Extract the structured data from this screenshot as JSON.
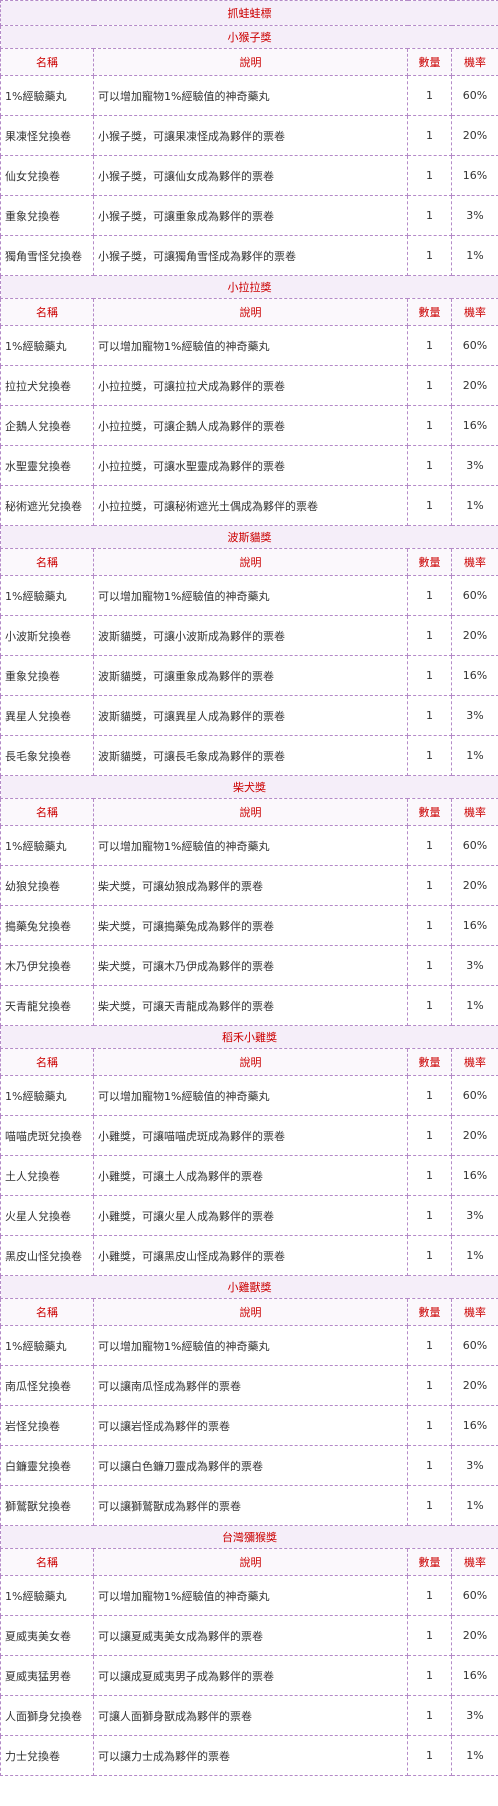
{
  "title": "抓蛙蛙標",
  "headers": {
    "name": "名稱",
    "desc": "說明",
    "qty": "數量",
    "rate": "機率"
  },
  "sections": [
    {
      "title": "小猴子獎",
      "rows": [
        {
          "name": "1%經驗藥丸",
          "desc": "可以增加寵物1%經驗值的神奇藥丸",
          "qty": "1",
          "rate": "60%"
        },
        {
          "name": "果凍怪兌換卷",
          "desc": "小猴子獎，可讓果凍怪成為夥伴的票卷",
          "qty": "1",
          "rate": "20%"
        },
        {
          "name": "仙女兌換卷",
          "desc": "小猴子獎，可讓仙女成為夥伴的票卷",
          "qty": "1",
          "rate": "16%"
        },
        {
          "name": "重象兌換卷",
          "desc": "小猴子獎，可讓重象成為夥伴的票卷",
          "qty": "1",
          "rate": "3%"
        },
        {
          "name": "獨角雪怪兌換卷",
          "desc": "小猴子獎，可讓獨角雪怪成為夥伴的票卷",
          "qty": "1",
          "rate": "1%"
        }
      ]
    },
    {
      "title": "小拉拉獎",
      "rows": [
        {
          "name": "1%經驗藥丸",
          "desc": "可以增加寵物1%經驗值的神奇藥丸",
          "qty": "1",
          "rate": "60%"
        },
        {
          "name": "拉拉犬兌換卷",
          "desc": "小拉拉獎，可讓拉拉犬成為夥伴的票卷",
          "qty": "1",
          "rate": "20%"
        },
        {
          "name": "企鵝人兌換卷",
          "desc": "小拉拉獎，可讓企鵝人成為夥伴的票卷",
          "qty": "1",
          "rate": "16%"
        },
        {
          "name": "水聖靈兌換卷",
          "desc": "小拉拉獎，可讓水聖靈成為夥伴的票卷",
          "qty": "1",
          "rate": "3%"
        },
        {
          "name": "秘術遮光兌換卷",
          "desc": "小拉拉獎，可讓秘術遮光土偶成為夥伴的票卷",
          "qty": "1",
          "rate": "1%"
        }
      ]
    },
    {
      "title": "波斯貓獎",
      "rows": [
        {
          "name": "1%經驗藥丸",
          "desc": "可以增加寵物1%經驗值的神奇藥丸",
          "qty": "1",
          "rate": "60%"
        },
        {
          "name": "小波斯兌換卷",
          "desc": "波斯貓獎，可讓小波斯成為夥伴的票卷",
          "qty": "1",
          "rate": "20%"
        },
        {
          "name": "重象兌換卷",
          "desc": "波斯貓獎，可讓重象成為夥伴的票卷",
          "qty": "1",
          "rate": "16%"
        },
        {
          "name": "異星人兌換卷",
          "desc": "波斯貓獎，可讓異星人成為夥伴的票卷",
          "qty": "1",
          "rate": "3%"
        },
        {
          "name": "長毛象兌換卷",
          "desc": "波斯貓獎，可讓長毛象成為夥伴的票卷",
          "qty": "1",
          "rate": "1%"
        }
      ]
    },
    {
      "title": "柴犬獎",
      "rows": [
        {
          "name": "1%經驗藥丸",
          "desc": "可以增加寵物1%經驗值的神奇藥丸",
          "qty": "1",
          "rate": "60%"
        },
        {
          "name": "幼狼兌換卷",
          "desc": "柴犬獎，可讓幼狼成為夥伴的票卷",
          "qty": "1",
          "rate": "20%"
        },
        {
          "name": "搗藥兔兌換卷",
          "desc": "柴犬獎，可讓搗藥兔成為夥伴的票卷",
          "qty": "1",
          "rate": "16%"
        },
        {
          "name": "木乃伊兌換卷",
          "desc": "柴犬獎，可讓木乃伊成為夥伴的票卷",
          "qty": "1",
          "rate": "3%"
        },
        {
          "name": "天青龍兌換卷",
          "desc": "柴犬獎，可讓天青龍成為夥伴的票卷",
          "qty": "1",
          "rate": "1%"
        }
      ]
    },
    {
      "title": "稻禾小雞獎",
      "rows": [
        {
          "name": "1%經驗藥丸",
          "desc": "可以增加寵物1%經驗值的神奇藥丸",
          "qty": "1",
          "rate": "60%"
        },
        {
          "name": "喵喵虎斑兌換卷",
          "desc": "小雞獎，可讓喵喵虎斑成為夥伴的票卷",
          "qty": "1",
          "rate": "20%"
        },
        {
          "name": "土人兌換卷",
          "desc": "小雞獎，可讓土人成為夥伴的票卷",
          "qty": "1",
          "rate": "16%"
        },
        {
          "name": "火星人兌換卷",
          "desc": "小雞獎，可讓火星人成為夥伴的票卷",
          "qty": "1",
          "rate": "3%"
        },
        {
          "name": "黑皮山怪兌換卷",
          "desc": "小雞獎，可讓黑皮山怪成為夥伴的票卷",
          "qty": "1",
          "rate": "1%"
        }
      ]
    },
    {
      "title": "小雞獸獎",
      "rows": [
        {
          "name": "1%經驗藥丸",
          "desc": "可以增加寵物1%經驗值的神奇藥丸",
          "qty": "1",
          "rate": "60%"
        },
        {
          "name": "南瓜怪兌換卷",
          "desc": "可以讓南瓜怪成為夥伴的票卷",
          "qty": "1",
          "rate": "20%"
        },
        {
          "name": "岩怪兌換卷",
          "desc": "可以讓岩怪成為夥伴的票卷",
          "qty": "1",
          "rate": "16%"
        },
        {
          "name": "白鐮靈兌換卷",
          "desc": "可以讓白色鐮刀靈成為夥伴的票卷",
          "qty": "1",
          "rate": "3%"
        },
        {
          "name": "獅鷲獸兌換卷",
          "desc": "可以讓獅鷲獸成為夥伴的票卷",
          "qty": "1",
          "rate": "1%"
        }
      ]
    },
    {
      "title": "台灣獼猴獎",
      "rows": [
        {
          "name": "1%經驗藥丸",
          "desc": "可以增加寵物1%經驗值的神奇藥丸",
          "qty": "1",
          "rate": "60%"
        },
        {
          "name": "夏威夷美女卷",
          "desc": "可以讓夏威夷美女成為夥伴的票卷",
          "qty": "1",
          "rate": "20%"
        },
        {
          "name": "夏威夷猛男卷",
          "desc": "可以讓成夏威夷男子成為夥伴的票卷",
          "qty": "1",
          "rate": "16%"
        },
        {
          "name": "人面獅身兌換卷",
          "desc": "可讓人面獅身獸成為夥伴的票卷",
          "qty": "1",
          "rate": "3%"
        },
        {
          "name": "力士兌換卷",
          "desc": "可以讓力士成為夥伴的票卷",
          "qty": "1",
          "rate": "1%"
        }
      ]
    }
  ]
}
